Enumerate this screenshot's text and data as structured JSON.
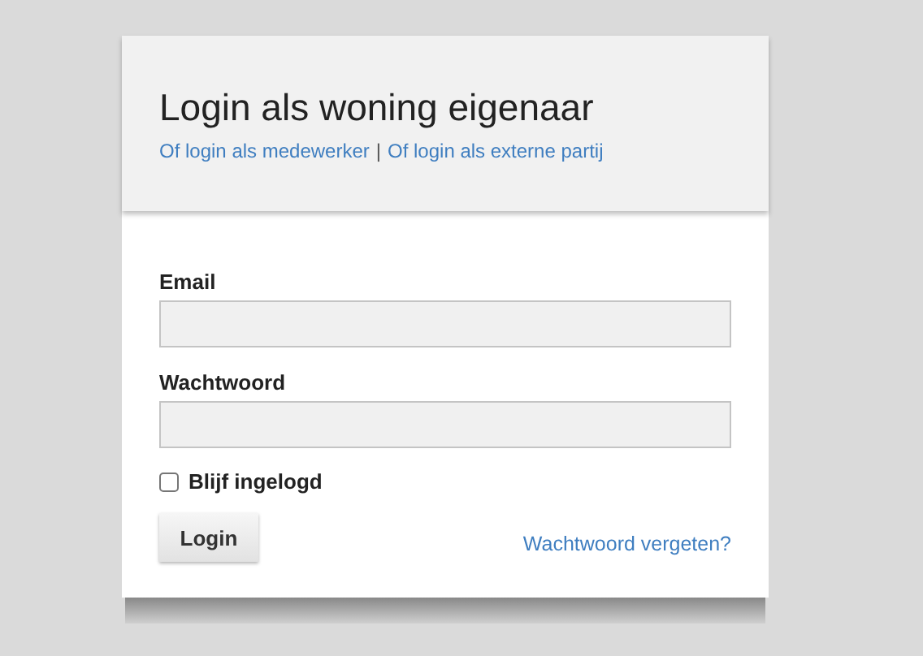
{
  "header": {
    "title": "Login als woning eigenaar",
    "links": [
      {
        "label": "Of login als medewerker"
      },
      {
        "label": "Of login als externe partij"
      }
    ],
    "separator": "|"
  },
  "form": {
    "fields": [
      {
        "label": "Email"
      },
      {
        "label": "Wachtwoord"
      }
    ],
    "remember": {
      "label": "Blijf ingelogd",
      "checked": false
    },
    "submit": "Login",
    "forgot_link": "Wachtwoord vergeten?"
  }
}
